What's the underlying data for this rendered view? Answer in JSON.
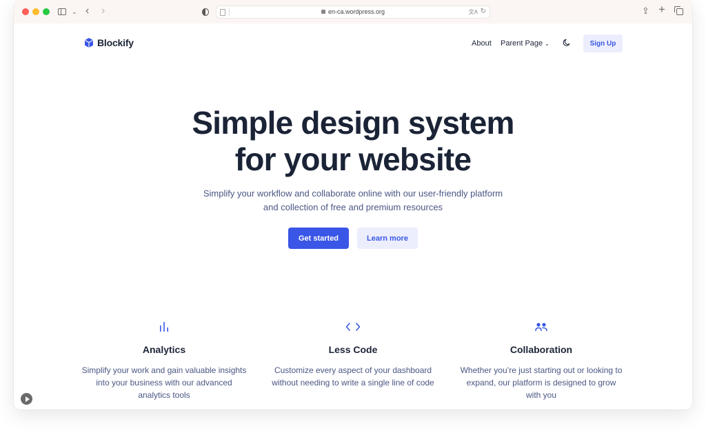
{
  "browser": {
    "url": "en-ca.wordpress.org",
    "icons": {
      "sidebar": "sidebar-icon",
      "back": "chevron-left-icon",
      "forward": "chevron-right-icon",
      "privacy": "shield-icon",
      "lock": "lock-icon",
      "translate": "translate-icon",
      "reload": "reload-icon",
      "share": "share-icon",
      "new_tab": "plus-icon",
      "tabs": "tabs-overview-icon"
    },
    "glyphs": {
      "sidebar_chevron": "⌄",
      "back": "‹",
      "forward": "›",
      "translate": "文A",
      "reload": "↻",
      "share": "⇪",
      "new_tab": "+"
    }
  },
  "site": {
    "brand": "Blockify",
    "brand_color": "#3a56e6",
    "nav": {
      "about": "About",
      "parent_page": "Parent Page",
      "parent_chevron": "⌄",
      "signup": "Sign Up"
    }
  },
  "hero": {
    "title_line1": "Simple design system",
    "title_line2": "for your website",
    "subtitle": "Simplify your workflow and collaborate online with our user-friendly platform and collection of free and premium resources",
    "primary_button": "Get started",
    "secondary_button": "Learn more"
  },
  "features": [
    {
      "icon": "bar-chart-icon",
      "title": "Analytics",
      "description": "Simplify your work and gain valuable insights into your business with our advanced analytics tools"
    },
    {
      "icon": "code-icon",
      "title": "Less Code",
      "description": "Customize every aspect of your dashboard without needing to write a single line of code"
    },
    {
      "icon": "users-icon",
      "title": "Collaboration",
      "description": "Whether you’re just starting out or looking to expand, our platform is designed to grow with you"
    }
  ],
  "colors": {
    "heading": "#1b2336",
    "body": "#4a5683",
    "accent": "#3a56e6",
    "accent_light": "#eceefd",
    "titlebar": "#fbf6f4"
  }
}
